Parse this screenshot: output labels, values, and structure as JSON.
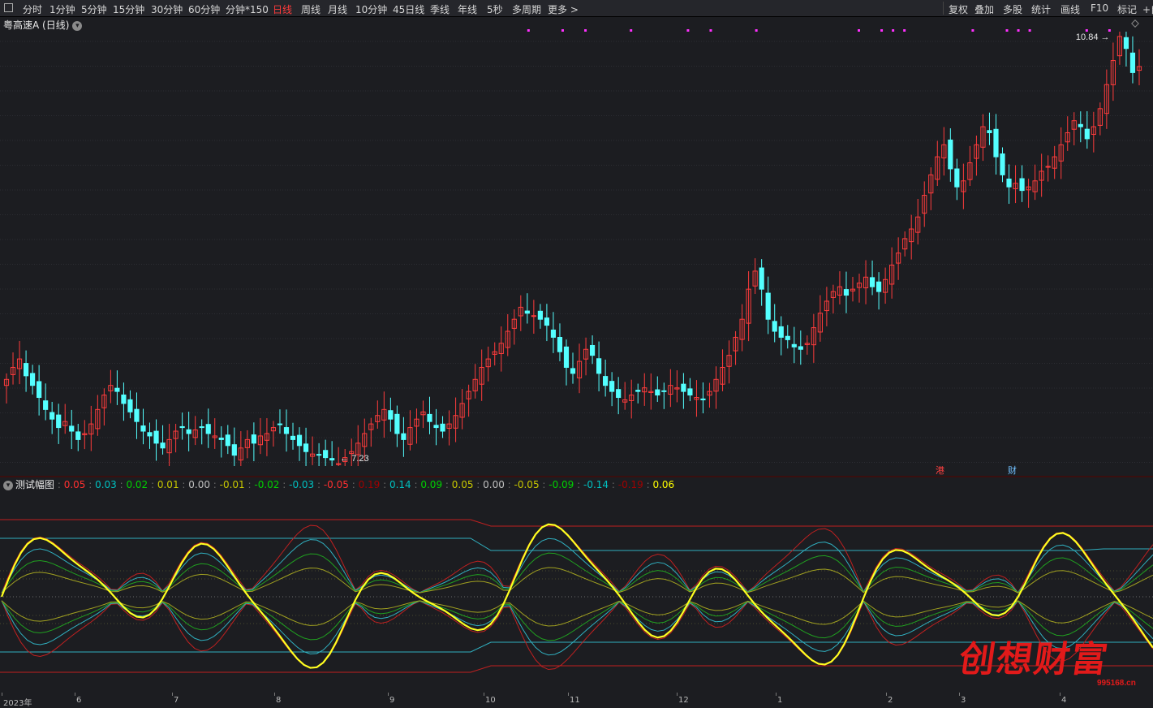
{
  "toolbar": {
    "items": [
      "分时",
      "1分钟",
      "5分钟",
      "15分钟",
      "30分钟",
      "60分钟",
      "分钟*150",
      "日线",
      "周线",
      "月线",
      "10分钟",
      "45日线",
      "季线",
      "年线",
      "5秒",
      "多周期",
      "更多 >"
    ],
    "active": "日线",
    "right_items": [
      "复权",
      "叠加",
      "多股",
      "统计",
      "画线",
      "F10",
      "标记",
      "+自"
    ]
  },
  "main_chart": {
    "title": "粤高速A (日线)",
    "high_label": "10.84",
    "low_label": "7.23",
    "markers": [
      "港",
      "财"
    ],
    "up_color": "#ff3c3c",
    "down_color": "#54ffff"
  },
  "indicator": {
    "name": "测试幅图",
    "values": [
      {
        "text": "0.05",
        "color": "#ff3030"
      },
      {
        "text": "0.03",
        "color": "#00c0c0"
      },
      {
        "text": "0.02",
        "color": "#00d000"
      },
      {
        "text": "0.01",
        "color": "#c8c800"
      },
      {
        "text": "0.00",
        "color": "#c0c0c0"
      },
      {
        "text": "-0.01",
        "color": "#c8c800"
      },
      {
        "text": "-0.02",
        "color": "#00d000"
      },
      {
        "text": "-0.03",
        "color": "#00c0c0"
      },
      {
        "text": "-0.05",
        "color": "#ff3030"
      },
      {
        "text": "0.19",
        "color": "#a00000"
      },
      {
        "text": "0.14",
        "color": "#00c0c0"
      },
      {
        "text": "0.09",
        "color": "#00d000"
      },
      {
        "text": "0.05",
        "color": "#c8c800"
      },
      {
        "text": "0.00",
        "color": "#c0c0c0"
      },
      {
        "text": "-0.05",
        "color": "#c8c800"
      },
      {
        "text": "-0.09",
        "color": "#00d000"
      },
      {
        "text": "-0.14",
        "color": "#00c0c0"
      },
      {
        "text": "-0.19",
        "color": "#a00000"
      },
      {
        "text": "0.06",
        "color": "#ffff00"
      }
    ]
  },
  "axis": {
    "labels": [
      "2023年",
      "6",
      "7",
      "8",
      "9",
      "10",
      "11",
      "12",
      "1",
      "2",
      "3",
      "4"
    ]
  },
  "watermark": {
    "text": "创想财富",
    "sub": "995168.cn"
  },
  "chart_data": {
    "type": "candlestick",
    "title": "粤高速A (日线)",
    "closes": [
      7.95,
      8.05,
      8.12,
      7.98,
      7.9,
      7.8,
      7.7,
      7.62,
      7.55,
      7.6,
      7.52,
      7.45,
      7.5,
      7.58,
      7.7,
      7.82,
      7.9,
      7.85,
      7.75,
      7.68,
      7.6,
      7.52,
      7.48,
      7.42,
      7.38,
      7.45,
      7.52,
      7.55,
      7.5,
      7.53,
      7.55,
      7.5,
      7.48,
      7.45,
      7.4,
      7.32,
      7.38,
      7.45,
      7.42,
      7.48,
      7.5,
      7.55,
      7.58,
      7.5,
      7.45,
      7.4,
      7.35,
      7.33,
      7.32,
      7.3,
      7.28,
      7.25,
      7.3,
      7.35,
      7.42,
      7.5,
      7.58,
      7.65,
      7.7,
      7.62,
      7.5,
      7.45,
      7.55,
      7.62,
      7.68,
      7.6,
      7.55,
      7.52,
      7.58,
      7.65,
      7.75,
      7.85,
      7.95,
      8.05,
      8.12,
      8.18,
      8.25,
      8.35,
      8.45,
      8.55,
      8.5,
      8.48,
      8.45,
      8.4,
      8.3,
      8.18,
      8.05,
      8.0,
      8.1,
      8.2,
      8.15,
      8.0,
      7.9,
      7.85,
      7.8,
      7.78,
      7.82,
      7.85,
      7.88,
      7.85,
      7.82,
      7.85,
      7.9,
      7.88,
      7.85,
      7.82,
      7.8,
      7.78,
      7.85,
      7.95,
      8.05,
      8.15,
      8.3,
      8.45,
      8.7,
      8.85,
      8.7,
      8.45,
      8.35,
      8.3,
      8.28,
      8.22,
      8.2,
      8.25,
      8.38,
      8.5,
      8.6,
      8.68,
      8.72,
      8.65,
      8.7,
      8.75,
      8.8,
      8.72,
      8.68,
      8.78,
      8.9,
      9.0,
      9.12,
      9.2,
      9.3,
      9.48,
      9.65,
      9.8,
      9.9,
      9.7,
      9.55,
      9.6,
      9.75,
      9.9,
      10.05,
      10.0,
      9.8,
      9.65,
      9.55,
      9.58,
      9.52,
      9.55,
      9.6,
      9.68,
      9.72,
      9.8,
      9.9,
      10.0,
      10.1,
      10.05,
      9.95,
      10.05,
      10.2,
      10.4,
      10.6,
      10.8,
      10.7,
      10.5,
      10.55
    ]
  }
}
